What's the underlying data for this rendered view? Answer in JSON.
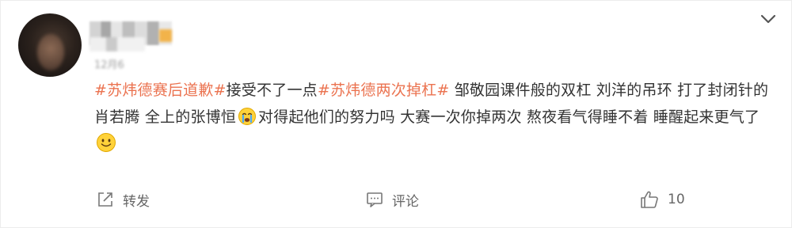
{
  "post": {
    "timestamp_blurred": "12月6",
    "content": {
      "hashtag1": "#苏炜德赛后道歉#",
      "text1": "接受不了一点",
      "hashtag2": "#苏炜德两次掉杠#",
      "text2": " 邹敬园课件般的双杠 刘洋的吊环 打了封闭针的肖若腾 全上的张博恒",
      "text3": "对得起他们的努力吗 大赛一次你掉两次 熬夜看气得睡不着 睡醒起来更气了"
    },
    "emojis": {
      "crying": "crying-face",
      "smile": "smile-face"
    }
  },
  "actions": {
    "repost_label": "转发",
    "comment_label": "评论",
    "like_count": "10"
  },
  "icons": {
    "menu": "chevron-down-icon",
    "repost": "share-icon",
    "comment": "comment-icon",
    "like": "thumbs-up-icon"
  },
  "colors": {
    "hashtag": "#eb7350",
    "text": "#333333",
    "muted": "#666666"
  }
}
